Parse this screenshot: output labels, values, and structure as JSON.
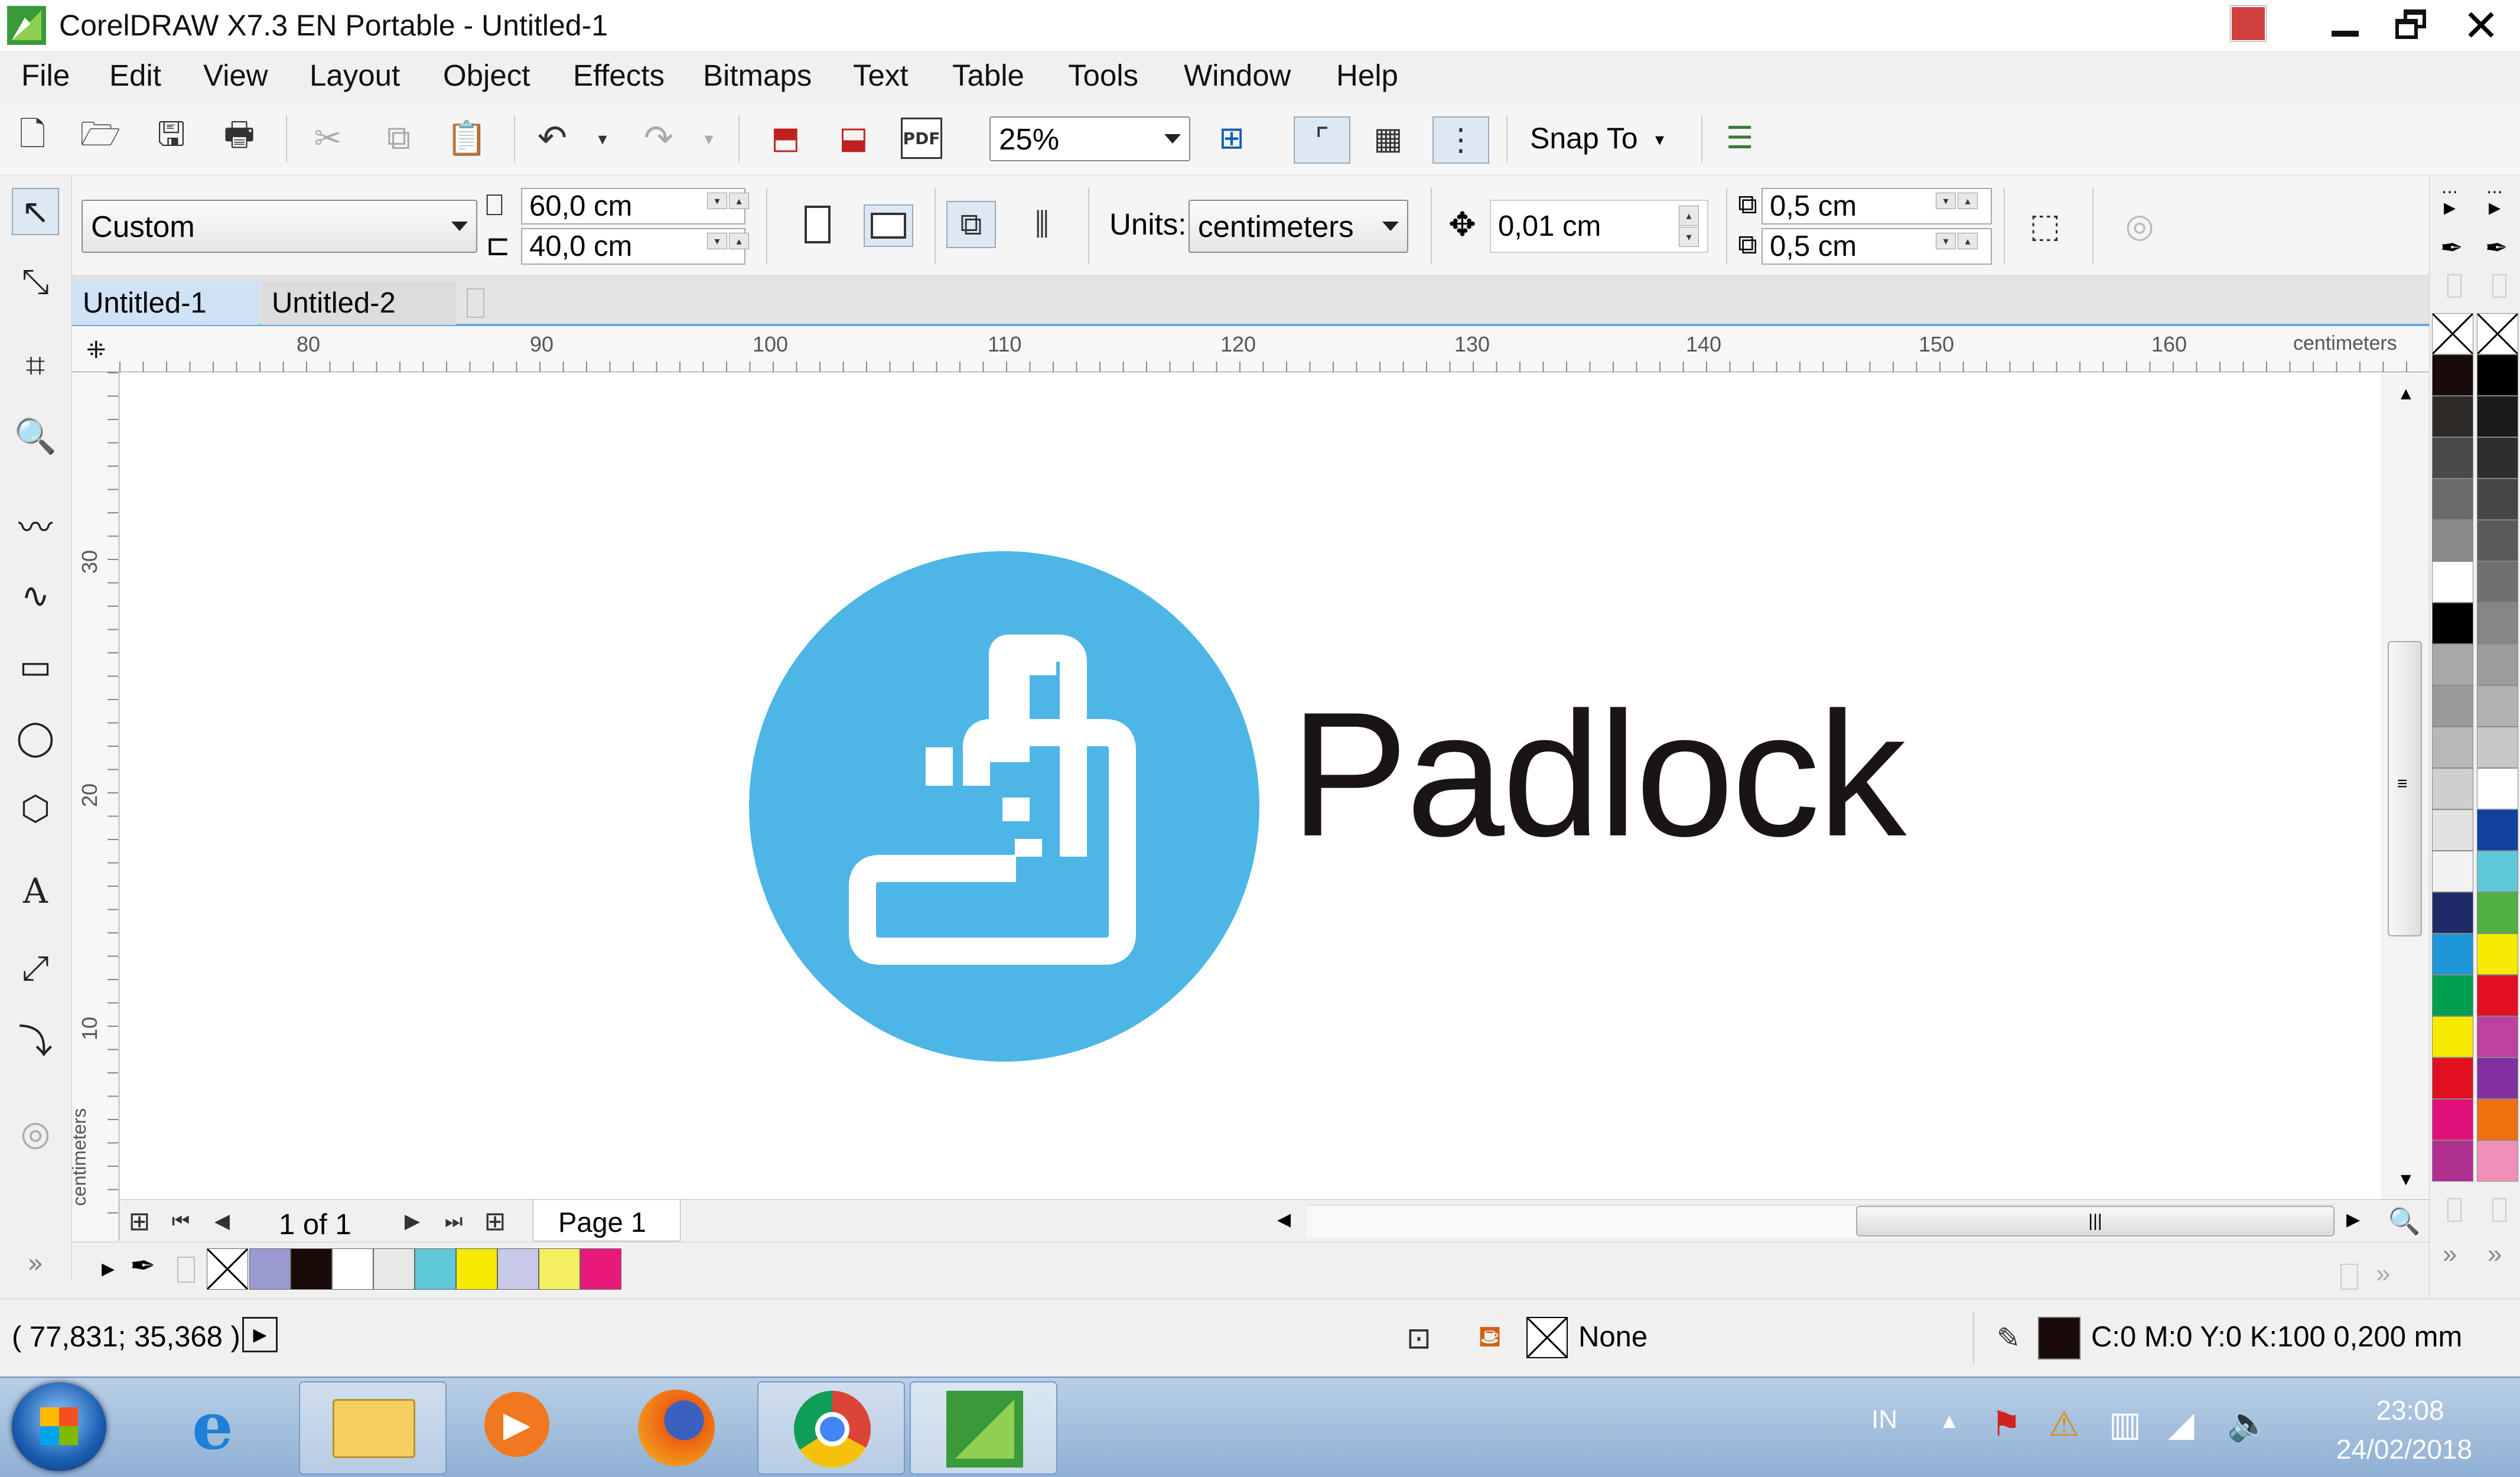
{
  "titlebar": {
    "title": "CorelDRAW X7.3 EN Portable - Untitled-1"
  },
  "menu": [
    "File",
    "Edit",
    "View",
    "Layout",
    "Object",
    "Effects",
    "Bitmaps",
    "Text",
    "Table",
    "Tools",
    "Window",
    "Help"
  ],
  "standard_toolbar": {
    "zoom": "25%",
    "snap_label": "Snap To"
  },
  "property_bar": {
    "page_size": "Custom",
    "width": "60,0 cm",
    "height": "40,0 cm",
    "units_label": "Units:",
    "units_value": "centimeters",
    "nudge": "0,01 cm",
    "dup_x": "0,5 cm",
    "dup_y": "0,5 cm"
  },
  "doc_tabs": [
    "Untitled-1",
    "Untitled-2"
  ],
  "ruler": {
    "h_ticks": [
      "80",
      "90",
      "100",
      "110",
      "120",
      "130",
      "140",
      "150",
      "160"
    ],
    "v_ticks": [
      "30",
      "20",
      "10"
    ],
    "units": "centimeters"
  },
  "logo": {
    "text": "Padlock",
    "circle_color": "#4db6e6",
    "text_color": "#1a1414"
  },
  "page_nav": {
    "counter": "1 of 1",
    "page_tab": "Page 1"
  },
  "status": {
    "coords": "( 77,831; 35,368 )",
    "fill_label": "None",
    "outline": "C:0 M:0 Y:0 K:100  0,200 mm"
  },
  "taskbar": {
    "lang": "IN",
    "time": "23:08",
    "date": "24/02/2018"
  },
  "doc_palette_colors": [
    "#9a9ad0",
    "#1a0a0a",
    "#ffffff",
    "#e8e8e8",
    "#5ec8d8",
    "#f5ea00",
    "#c8c8e8",
    "#f5ee60",
    "#e8197a"
  ],
  "palette_col1": [
    "#1a0a0a",
    "#2e2a28",
    "#4a4a4a",
    "#6a6a6a",
    "#8a8a8a",
    "#ffffff",
    "#000000",
    "#a8a8a8",
    "#9a9a9a",
    "#b8b8b8",
    "#cfcfcf",
    "#e2e2e2",
    "#f2f2f2",
    "#1e2a68",
    "#1e96d8",
    "#00a050",
    "#f5ea00",
    "#e01020",
    "#e0107a",
    "#b03090"
  ],
  "palette_col2": [
    "#000000",
    "#1a1a1a",
    "#2e2e2e",
    "#454545",
    "#5a5a5a",
    "#707070",
    "#868686",
    "#9c9c9c",
    "#b2b2b2",
    "#c8c8c8",
    "#ffffff",
    "#1040a0",
    "#5ec8d8",
    "#50b040",
    "#f5ea00",
    "#e01020",
    "#c040a0",
    "#8030a0",
    "#f07010",
    "#f090b8"
  ]
}
